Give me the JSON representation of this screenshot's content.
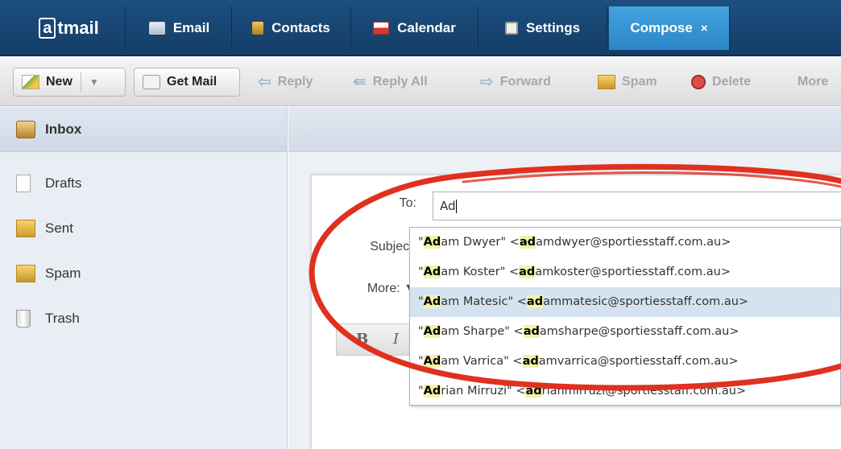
{
  "topnav": {
    "brand_prefix": "a",
    "brand_rest": "tmail",
    "tabs": [
      "Email",
      "Contacts",
      "Calendar",
      "Settings"
    ],
    "compose_tab": "Compose",
    "compose_close": "×"
  },
  "toolbar": {
    "new": "New",
    "new_arrow": "▼",
    "get_mail": "Get Mail",
    "reply": "Reply",
    "reply_all": "Reply All",
    "forward": "Forward",
    "spam": "Spam",
    "delete": "Delete",
    "more": "More"
  },
  "sidebar": {
    "inbox": "Inbox",
    "folders": [
      "Drafts",
      "Sent",
      "Spam",
      "Trash"
    ]
  },
  "compose": {
    "to_label": "To:",
    "subject_label": "Subject:",
    "more_label": "More: ▼",
    "to_value": "Ad",
    "format_bold": "B",
    "format_italic": "I"
  },
  "autocomplete": {
    "query": "Ad",
    "selected_index": 2,
    "items": [
      {
        "match": "Ad",
        "name_rest": "am Dwyer",
        "email_match": "ad",
        "email_rest": "amdwyer@sportiesstaff.com.au"
      },
      {
        "match": "Ad",
        "name_rest": "am Koster",
        "email_match": "ad",
        "email_rest": "amkoster@sportiesstaff.com.au"
      },
      {
        "match": "Ad",
        "name_rest": "am Matesic",
        "email_match": "ad",
        "email_rest": "ammatesic@sportiesstaff.com.au"
      },
      {
        "match": "Ad",
        "name_rest": "am Sharpe",
        "email_match": "ad",
        "email_rest": "amsharpe@sportiesstaff.com.au"
      },
      {
        "match": "Ad",
        "name_rest": "am Varrica",
        "email_match": "ad",
        "email_rest": "amvarrica@sportiesstaff.com.au"
      },
      {
        "match": "Ad",
        "name_rest": "rian Mirruzi",
        "email_match": "ad",
        "email_rest": "rianmirruzi@sportiesstaff.com.au"
      }
    ]
  },
  "colors": {
    "nav_bg": "#1d4f7f",
    "compose_tab_bg": "#43a2e0",
    "selected_row": "#d5e3f0",
    "annotation": "#e0301e"
  }
}
